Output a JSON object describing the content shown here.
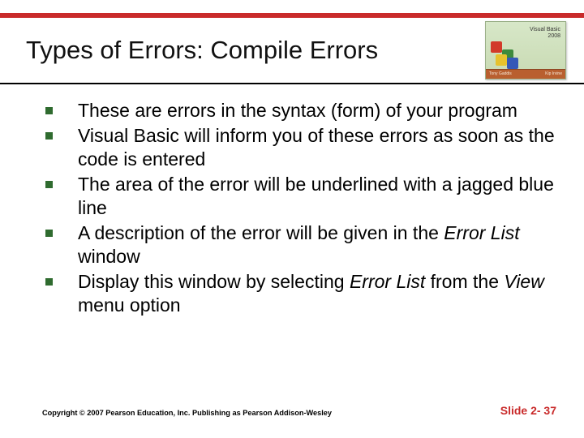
{
  "title": "Types of Errors: Compile Errors",
  "bookcover": {
    "line1": "Visual Basic",
    "line2": "2008",
    "author1": "Tony Gaddis",
    "author2": "Kip Irvine"
  },
  "bullets": [
    {
      "pre": "These are errors in the syntax (form) of your program",
      "italic1": "",
      "mid": "",
      "italic2": "",
      "post": ""
    },
    {
      "pre": "Visual Basic will inform you of these errors as soon as the code is entered",
      "italic1": "",
      "mid": "",
      "italic2": "",
      "post": ""
    },
    {
      "pre": "The area of the error will be underlined with a jagged blue line",
      "italic1": "",
      "mid": "",
      "italic2": "",
      "post": ""
    },
    {
      "pre": "A description of the error will be given in the ",
      "italic1": "Error List",
      "mid": " window",
      "italic2": "",
      "post": ""
    },
    {
      "pre": "Display this window by selecting ",
      "italic1": "Error List",
      "mid": " from the ",
      "italic2": "View",
      "post": " menu option"
    }
  ],
  "footer": {
    "copyright": "Copyright © 2007 Pearson Education, Inc. Publishing as Pearson Addison-Wesley",
    "slidenum": "Slide 2- 37"
  }
}
